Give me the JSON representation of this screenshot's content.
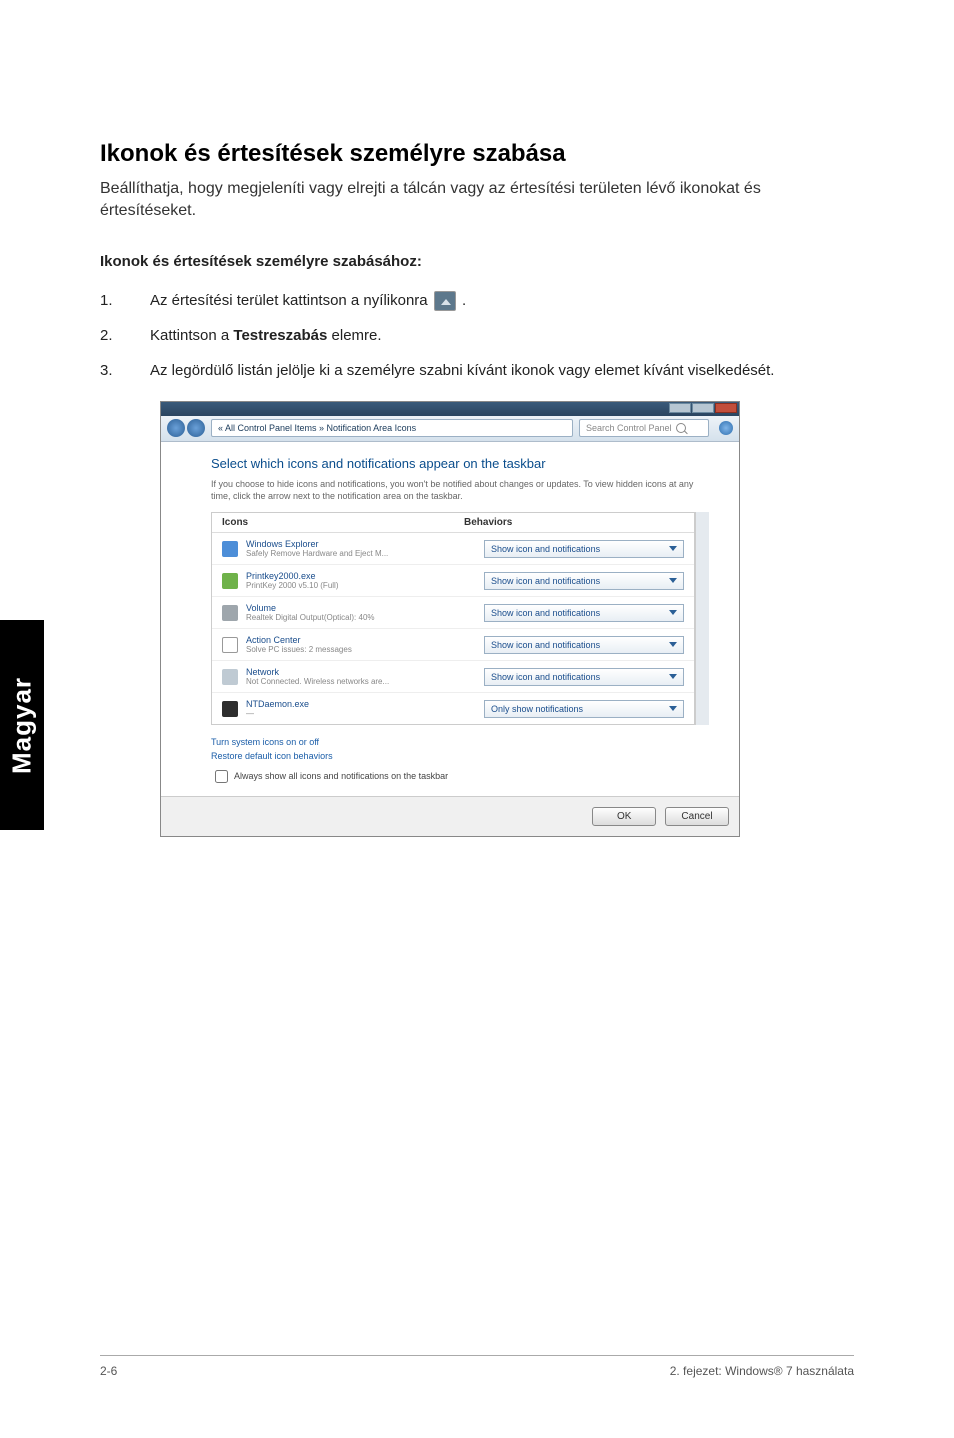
{
  "heading": "Ikonok és értesítések személyre szabása",
  "intro": "Beállíthatja, hogy megjeleníti vagy elrejti a tálcán vagy az értesítési területen lévő ikonokat és értesítéseket.",
  "subhead": "Ikonok és értesítések személyre szabásához:",
  "steps": {
    "s1a": "Az értesítési terület kattintson a nyílikonra ",
    "s1b": ".",
    "s2a": "Kattintson a ",
    "s2b": "Testreszabás",
    "s2c": " elemre.",
    "s3": "Az legördülő listán jelölje ki a személyre szabni kívánt ikonok vagy elemet kívánt viselkedését."
  },
  "shot": {
    "breadcrumb": "« All Control Panel Items » Notification Area Icons",
    "searchPlaceholder": "Search Control Panel",
    "title": "Select which icons and notifications appear on the taskbar",
    "hint": "If you choose to hide icons and notifications, you won't be notified about changes or updates. To view hidden icons at any time, click the arrow next to the notification area on the taskbar.",
    "col1": "Icons",
    "col2": "Behaviors",
    "rows": [
      {
        "name": "Windows Explorer",
        "sub": "Safely Remove Hardware and Eject M...",
        "opt": "Show icon and notifications",
        "ic": "blue"
      },
      {
        "name": "Printkey2000.exe",
        "sub": "PrintKey 2000 v5.10 (Full)",
        "opt": "Show icon and notifications",
        "ic": "green"
      },
      {
        "name": "Volume",
        "sub": "Realtek Digital Output(Optical): 40%",
        "opt": "Show icon and notifications",
        "ic": "gray"
      },
      {
        "name": "Action Center",
        "sub": "Solve PC issues: 2 messages",
        "opt": "Show icon and notifications",
        "ic": "flag"
      },
      {
        "name": "Network",
        "sub": "Not Connected. Wireless networks are...",
        "opt": "Show icon and notifications",
        "ic": "sig"
      },
      {
        "name": "NTDaemon.exe",
        "sub": "—",
        "opt": "Only show notifications",
        "ic": "dark"
      }
    ],
    "link1": "Turn system icons on or off",
    "link2": "Restore default icon behaviors",
    "checkbox": "Always show all icons and notifications on the taskbar",
    "ok": "OK",
    "cancel": "Cancel"
  },
  "sidetab": "Magyar",
  "footer": {
    "left": "2-6",
    "right": "2. fejezet: Windows® 7 használata"
  }
}
